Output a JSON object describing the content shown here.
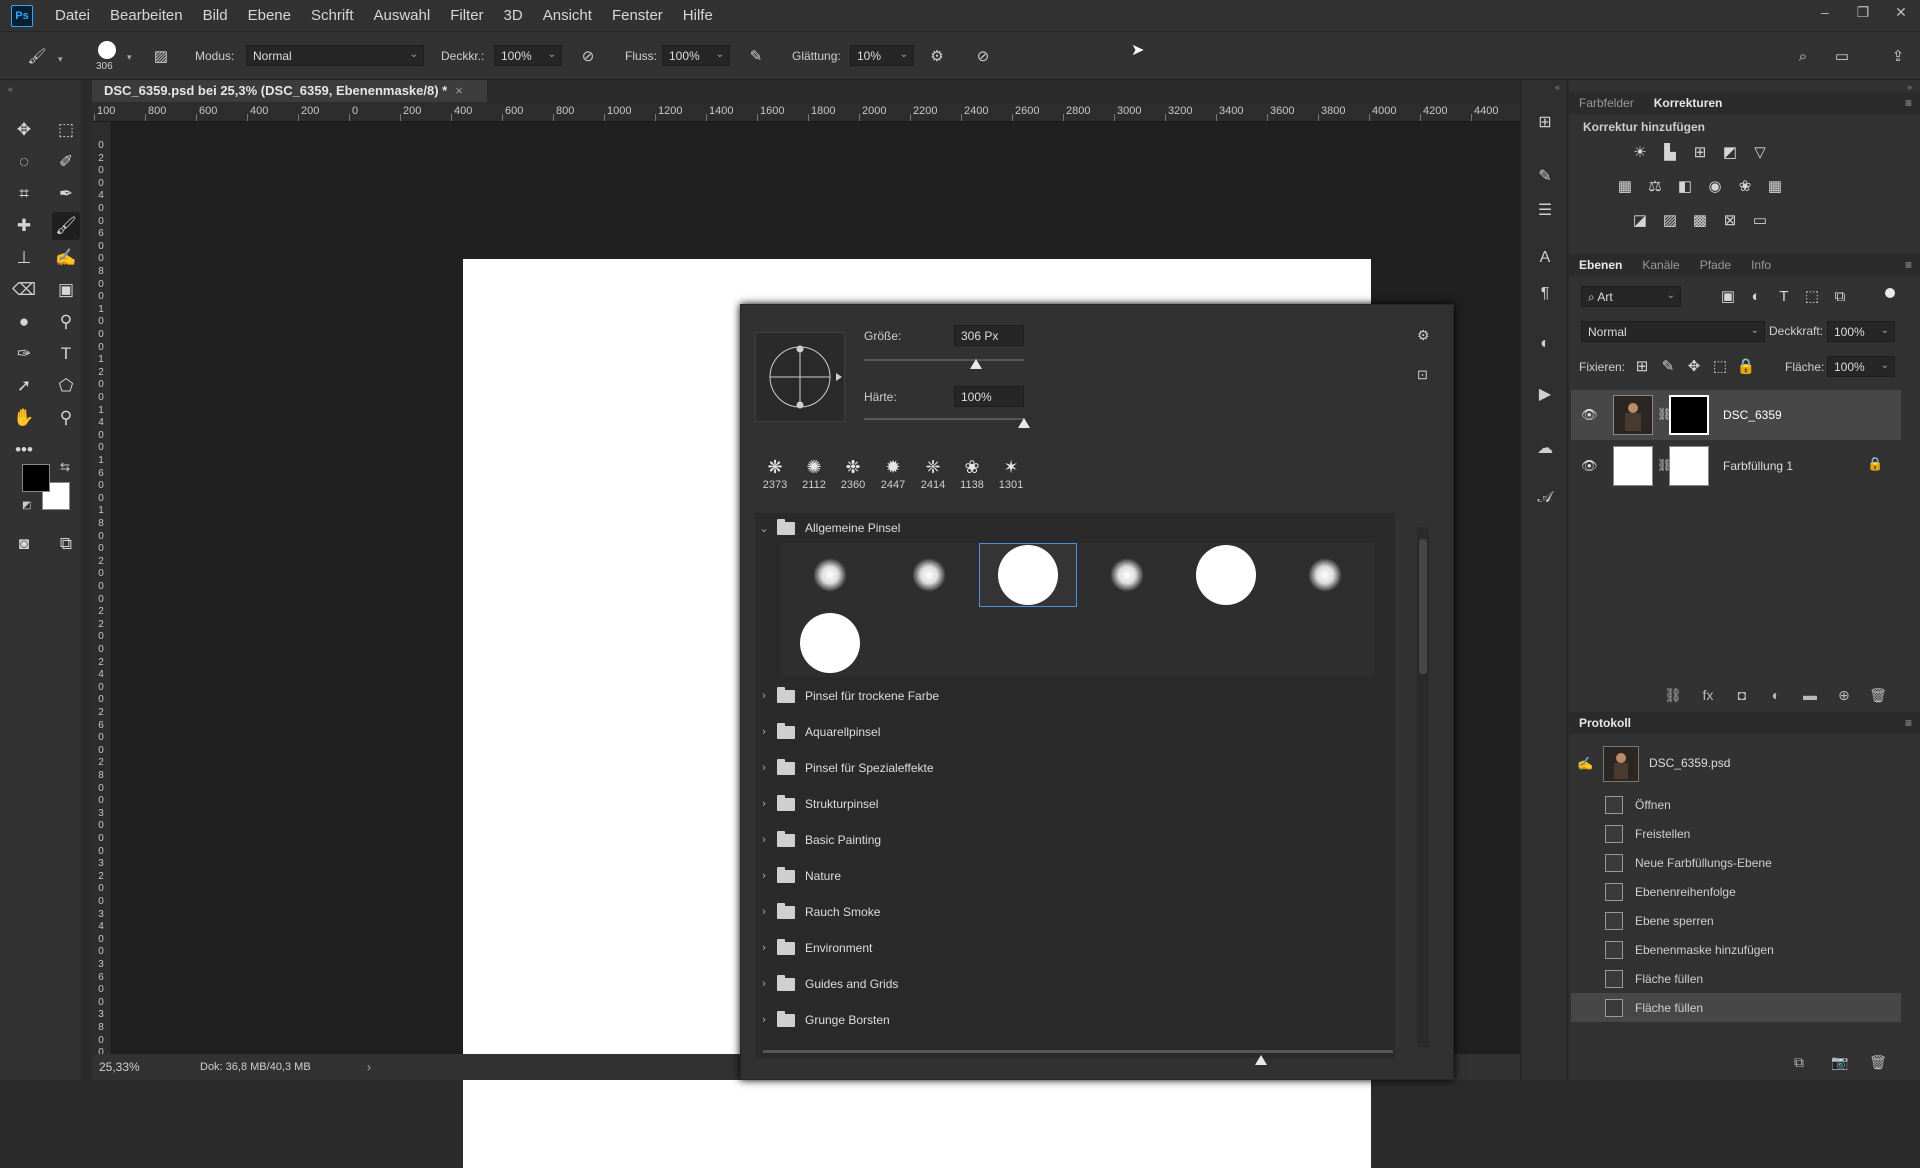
{
  "app": {
    "logo": "Ps"
  },
  "menu": [
    "Datei",
    "Bearbeiten",
    "Bild",
    "Ebene",
    "Schrift",
    "Auswahl",
    "Filter",
    "3D",
    "Ansicht",
    "Fenster",
    "Hilfe"
  ],
  "window_controls": {
    "minimize": "–",
    "restore": "❐",
    "close": "✕"
  },
  "options": {
    "brush_size": "306",
    "mode_label": "Modus:",
    "mode_value": "Normal",
    "opacity_label": "Deckkr.:",
    "opacity_value": "100%",
    "flow_label": "Fluss:",
    "flow_value": "100%",
    "smoothing_label": "Glättung:",
    "smoothing_value": "10%"
  },
  "document": {
    "tab_title": "DSC_6359.psd bei 25,3% (DSC_6359, Ebenenmaske/8) *",
    "close": "×",
    "zoom": "25,33%",
    "doc_info": "Dok: 36,8 MB/40,3 MB"
  },
  "ruler_h_labels": [
    "100",
    "800",
    "600",
    "400",
    "200",
    "0",
    "200",
    "400",
    "600",
    "800",
    "1000",
    "1200",
    "1400",
    "1600",
    "1800",
    "2000",
    "2200",
    "2400",
    "2600",
    "2800",
    "3000",
    "3200",
    "3400",
    "3600",
    "3800",
    "4000",
    "4200",
    "4400"
  ],
  "ruler_v_labels": [
    "0",
    "2",
    "0",
    "0",
    "4",
    "0",
    "0",
    "6",
    "0",
    "0",
    "8",
    "0",
    "0",
    "1",
    "0",
    "0",
    "0",
    "1",
    "2",
    "0",
    "0",
    "1",
    "4",
    "0",
    "0",
    "1",
    "6",
    "0",
    "0",
    "1",
    "8",
    "0",
    "0",
    "2",
    "0",
    "0",
    "0",
    "2",
    "2",
    "0",
    "0",
    "2",
    "4",
    "0",
    "0",
    "2",
    "6",
    "0",
    "0",
    "2",
    "8",
    "0",
    "0",
    "3",
    "0",
    "0",
    "0",
    "3",
    "2",
    "0",
    "0",
    "3",
    "4",
    "0",
    "0",
    "3",
    "6",
    "0",
    "0",
    "3",
    "8",
    "0",
    "0",
    "4"
  ],
  "brush_popup": {
    "size_label": "Größe:",
    "size_value": "306 Px",
    "size_level": 0.7,
    "hardness_label": "Härte:",
    "hardness_value": "100%",
    "hardness_level": 1.0,
    "recent": [
      "2373",
      "2112",
      "2360",
      "2447",
      "2414",
      "1138",
      "1301"
    ],
    "open_group": "Allgemeine Pinsel",
    "groups": [
      "Pinsel für trockene Farbe",
      "Aquarellpinsel",
      "Pinsel für Spezialeffekte",
      "Strukturpinsel",
      "Basic Painting",
      "Nature",
      "Rauch Smoke",
      "Environment",
      "Guides and Grids",
      "Grunge Borsten"
    ]
  },
  "adjust_panel": {
    "tabs": [
      "Farbfelder",
      "Korrekturen"
    ],
    "active_tab": "Korrekturen",
    "heading": "Korrektur hinzufügen"
  },
  "layers_panel": {
    "tabs": [
      "Ebenen",
      "Kanäle",
      "Pfade",
      "Info"
    ],
    "active_tab": "Ebenen",
    "filter": "Art",
    "blend_mode": "Normal",
    "opacity_label": "Deckkraft:",
    "opacity_value": "100%",
    "lock_label": "Fixieren:",
    "fill_label": "Fläche:",
    "fill_value": "100%",
    "layers": [
      {
        "name": "DSC_6359",
        "selected": true
      },
      {
        "name": "Farbfüllung 1",
        "selected": false
      }
    ]
  },
  "history_panel": {
    "title": "Protokoll",
    "snapshot": "DSC_6359.psd",
    "items": [
      "Öffnen",
      "Freistellen",
      "Neue Farbfüllungs-Ebene",
      "Ebenenreihenfolge",
      "Ebene sperren",
      "Ebenenmaske hinzufügen",
      "Fläche füllen",
      "Fläche füllen"
    ],
    "selected_index": 7
  },
  "colors": {
    "accent": "#31a8ff",
    "foreground": "#000000",
    "background": "#ffffff"
  }
}
